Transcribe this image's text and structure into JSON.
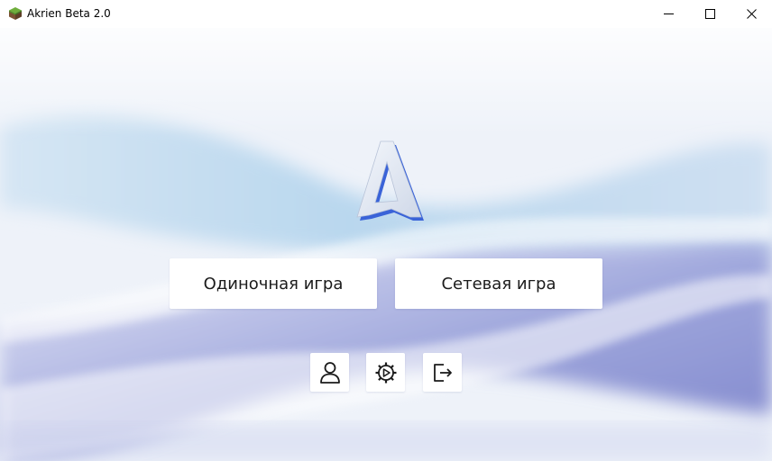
{
  "window": {
    "title": "Akrien Beta 2.0",
    "icons": {
      "app": "grass-block-icon",
      "minimize": "minimize-icon",
      "maximize": "maximize-icon",
      "close": "close-icon"
    }
  },
  "main": {
    "logo": "akrien-logo",
    "buttons": {
      "singleplayer": "Одиночная игра",
      "multiplayer": "Сетевая игра"
    },
    "icon_buttons": [
      "profile-icon",
      "settings-gear-icon",
      "exit-icon"
    ]
  },
  "colors": {
    "accent": "#3a63d8",
    "button_bg": "#ffffff",
    "wave_blue": "#a9cdea",
    "wave_violet": "#8f90d8"
  }
}
